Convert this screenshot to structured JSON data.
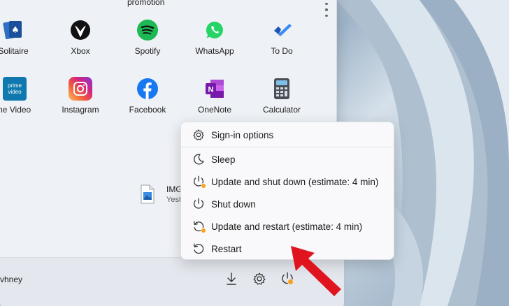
{
  "start": {
    "promo_label": "promotion",
    "apps_row1": [
      {
        "label": "Solitaire",
        "icon": "solitaire-icon"
      },
      {
        "label": "Xbox",
        "icon": "xbox-icon"
      },
      {
        "label": "Spotify",
        "icon": "spotify-icon"
      },
      {
        "label": "WhatsApp",
        "icon": "whatsapp-icon"
      },
      {
        "label": "To Do",
        "icon": "todo-icon"
      }
    ],
    "apps_row2": [
      {
        "label": "me Video",
        "icon": "prime-video-icon"
      },
      {
        "label": "Instagram",
        "icon": "instagram-icon"
      },
      {
        "label": "Facebook",
        "icon": "facebook-icon"
      },
      {
        "label": "OneNote",
        "icon": "onenote-icon"
      },
      {
        "label": "Calculator",
        "icon": "calculator-icon"
      }
    ],
    "prime_text": "prime video",
    "recent": {
      "name": "IMG",
      "time": "Yest"
    },
    "user_name": "vhney"
  },
  "power_menu": {
    "items": [
      {
        "label": "Sign-in options",
        "icon": "gear-icon"
      },
      {
        "label": "Sleep",
        "icon": "moon-icon"
      },
      {
        "label": "Update and shut down (estimate: 4 min)",
        "icon": "power-update-icon"
      },
      {
        "label": "Shut down",
        "icon": "power-icon"
      },
      {
        "label": "Update and restart (estimate: 4 min)",
        "icon": "restart-update-icon"
      },
      {
        "label": "Restart",
        "icon": "restart-icon"
      }
    ]
  },
  "colors": {
    "accent_orange": "#f7a21b",
    "annotation_red": "#e0141e"
  }
}
